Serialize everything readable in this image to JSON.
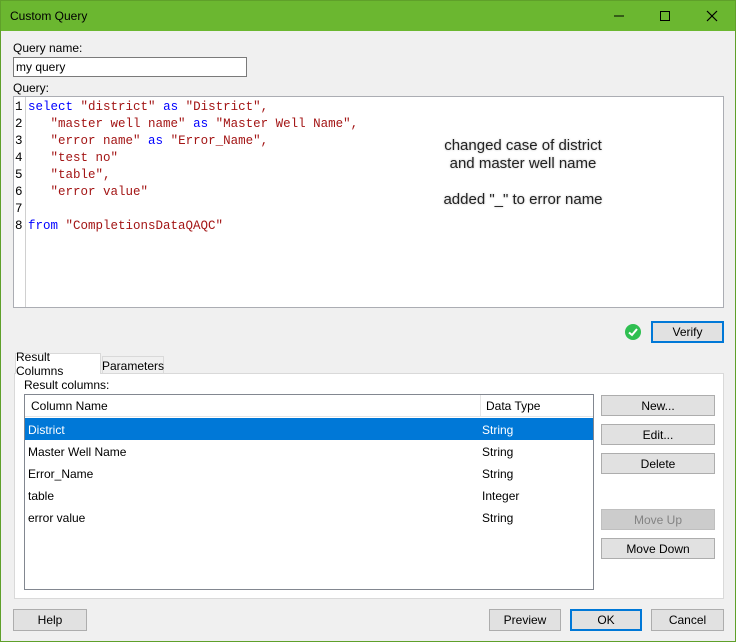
{
  "window": {
    "title": "Custom Query"
  },
  "form": {
    "query_name_label": "Query name:",
    "query_name_value": "my query",
    "query_label": "Query:"
  },
  "editor": {
    "line_numbers": [
      "1",
      "2",
      "3",
      "4",
      "5",
      "6",
      "7",
      "8"
    ],
    "lines": {
      "l1_kw": "select",
      "l1_str": "\"district\"",
      "l1_as": "as",
      "l1_alias": "\"District\",",
      "l2_str": "\"master well name\"",
      "l2_as": "as",
      "l2_alias": "\"Master Well Name\",",
      "l3_str": "\"error name\"",
      "l3_as": "as",
      "l3_alias": "\"Error_Name\",",
      "l4_str": "\"test no\"",
      "l5_str": "\"table\",",
      "l6_str": "\"error value\"",
      "l8_kw": "from",
      "l8_str": "\"CompletionsDataQAQC\""
    },
    "note_line1": "changed case of district",
    "note_line2": "and master well name",
    "note_line3": "added \"_\" to error name"
  },
  "verify_label": "Verify",
  "tabs": [
    {
      "label": "Result Columns"
    },
    {
      "label": "Parameters"
    }
  ],
  "result": {
    "label": "Result columns:",
    "headers": {
      "name": "Column Name",
      "type": "Data Type"
    },
    "rows": [
      {
        "name": "District",
        "type": "String"
      },
      {
        "name": "Master Well Name",
        "type": "String"
      },
      {
        "name": "Error_Name",
        "type": "String"
      },
      {
        "name": "table",
        "type": "Integer"
      },
      {
        "name": "error value",
        "type": "String"
      }
    ]
  },
  "side_buttons": {
    "new": "New...",
    "edit": "Edit...",
    "delete": "Delete",
    "move_up": "Move Up",
    "move_down": "Move Down"
  },
  "footer": {
    "help": "Help",
    "preview": "Preview",
    "ok": "OK",
    "cancel": "Cancel"
  }
}
